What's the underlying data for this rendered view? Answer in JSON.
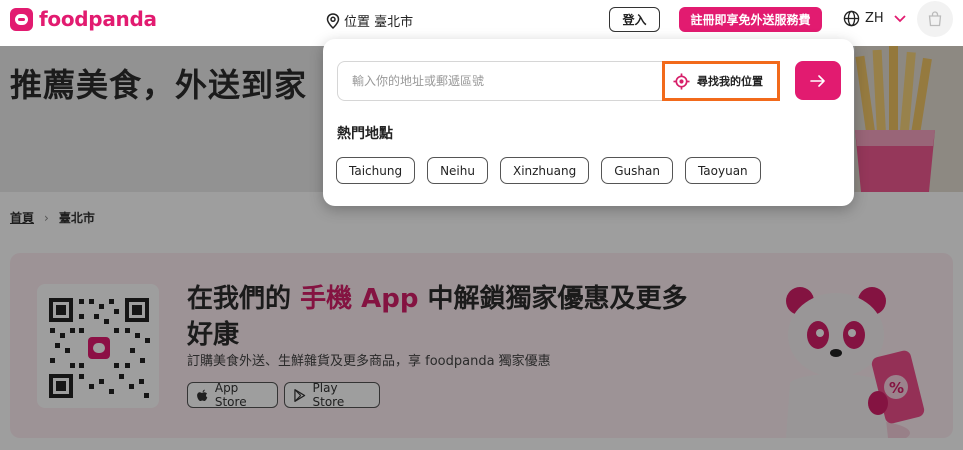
{
  "header": {
    "logo_text": "foodpanda",
    "location_label": "位置 臺北市",
    "login_label": "登入",
    "signup_label": "註冊即享免外送服務費",
    "language_label": "ZH"
  },
  "hero": {
    "title": "推薦美食，外送到家"
  },
  "breadcrumb": {
    "home": "首頁",
    "separator": "›",
    "current": "臺北市"
  },
  "promo": {
    "title_prefix": "在我們的 ",
    "title_highlight": "手機 App",
    "title_suffix": " 中解鎖獨家優惠及更多好康",
    "subtitle": "訂購美食外送、生鮮雜貨及更多商品，享 foodpanda 獨家優惠",
    "app_store_label": "App Store",
    "play_store_label": "Play Store"
  },
  "popup": {
    "address_placeholder": "輸入你的地址或郵遞區號",
    "find_location_label": "尋找我的位置",
    "popular_title": "熱門地點",
    "popular_locations": [
      "Taichung",
      "Neihu",
      "Xinzhuang",
      "Gushan",
      "Taoyuan"
    ]
  },
  "colors": {
    "brand": "#e21b70",
    "highlight_border": "#f26a1b"
  }
}
